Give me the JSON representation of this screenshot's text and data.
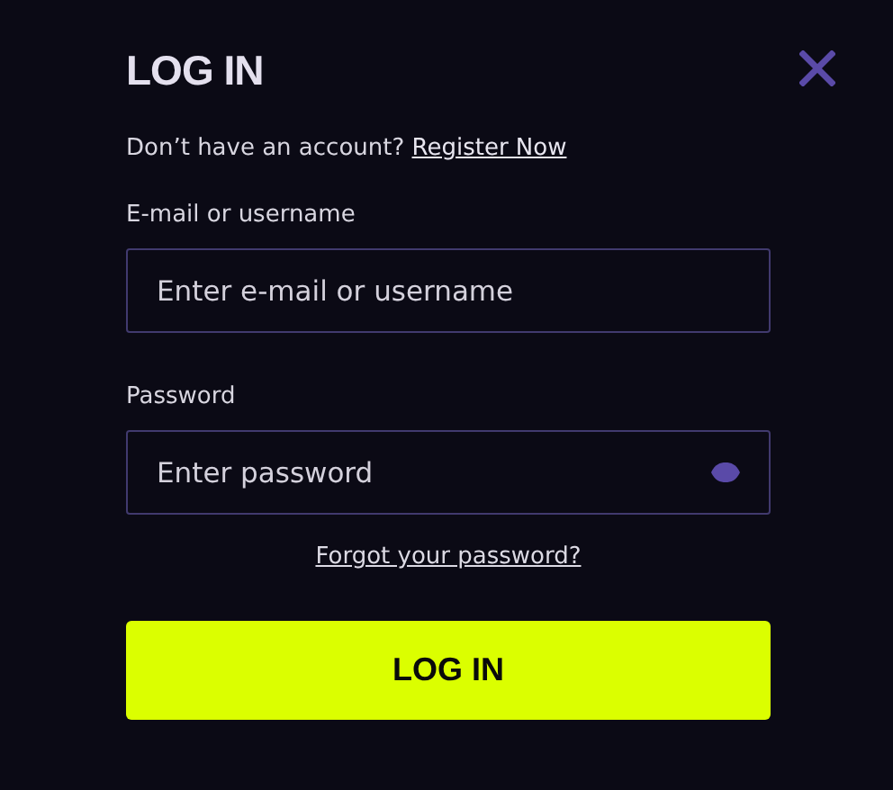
{
  "title": "LOG IN",
  "register": {
    "prompt": "Don’t have an account?",
    "link": "Register Now"
  },
  "fields": [
    {
      "label": "E-mail or username",
      "placeholder": "Enter e-mail or username",
      "kind": "text"
    },
    {
      "label": "Password",
      "placeholder": "Enter password",
      "kind": "password"
    }
  ],
  "forgot_link": "Forgot your password?",
  "submit": "LOG IN"
}
